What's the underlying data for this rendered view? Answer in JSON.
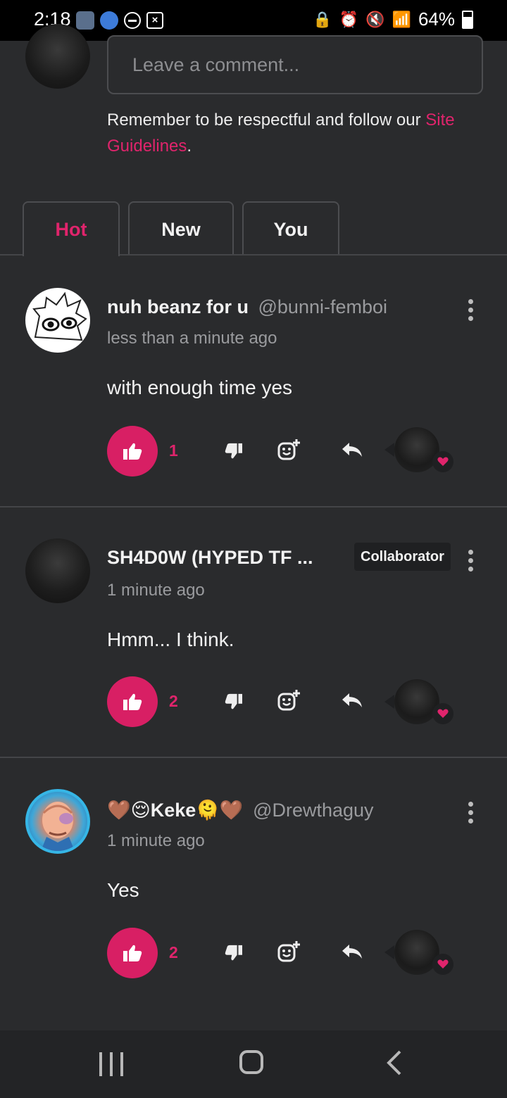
{
  "status_bar": {
    "time": "2:18",
    "battery": "64%",
    "battery_level": 0.64
  },
  "composer": {
    "placeholder": "Leave a comment...",
    "guidelines_text": "Remember to be respectful and follow our",
    "guidelines_link": "Site Guidelines",
    "guidelines_end": "."
  },
  "tabs": [
    {
      "label": "Hot",
      "active": true
    },
    {
      "label": "New",
      "active": false
    },
    {
      "label": "You",
      "active": false
    }
  ],
  "comments": [
    {
      "name": "nuh beanz for u",
      "handle": "@bunni-femboi",
      "time": "less than a minute ago",
      "text": "with enough time yes",
      "likes": "1",
      "badge": ""
    },
    {
      "name": "SH4D0W (HYPED TF ...",
      "handle": "",
      "time": "1 minute ago",
      "text": "Hmm... I think.",
      "likes": "2",
      "badge": "Collaborator"
    },
    {
      "name": "🤎😌Keke🫠🤎",
      "handle": "@Drewthaguy",
      "time": "1 minute ago",
      "text": "Yes",
      "likes": "2",
      "badge": ""
    }
  ],
  "colors": {
    "accent": "#e0246c",
    "background": "#2a2b2d",
    "like_button": "#d81f64"
  }
}
